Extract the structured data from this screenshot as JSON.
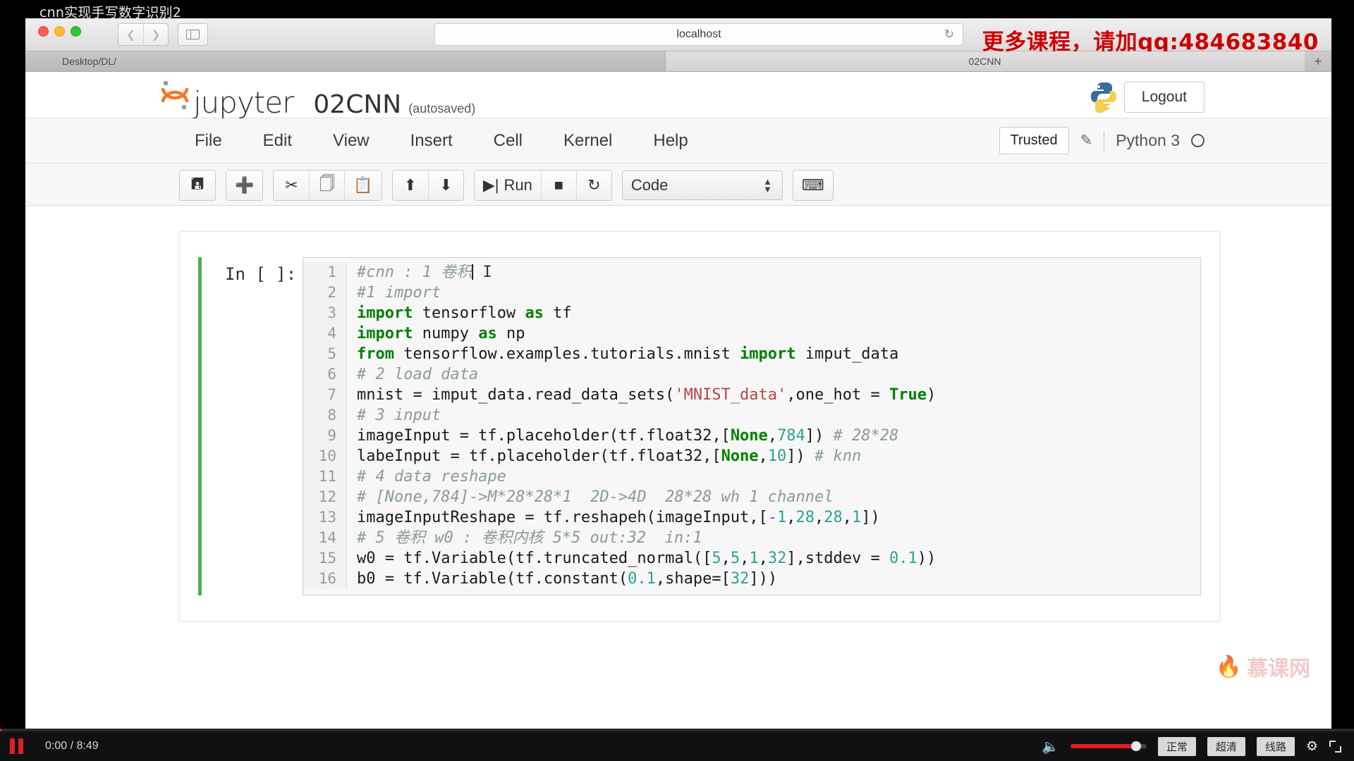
{
  "video": {
    "title": "cnn实现手写数字识别2",
    "pause_icon": "pause-icon",
    "timecode": "0:00 / 8:49",
    "quality_buttons": [
      "正常",
      "超清",
      "线路"
    ],
    "speaker_icon": "volume-icon",
    "gear_icon": "settings-gear-icon",
    "fullscreen_icon": "fullscreen-icon",
    "volume_percent": 85
  },
  "browser": {
    "traffic_lights": [
      "close",
      "minimize",
      "maximize"
    ],
    "back_icon": "chevron-left-icon",
    "forward_icon": "chevron-right-icon",
    "sidebar_icon": "sidebar-toggle-icon",
    "url": "localhost",
    "reload_icon": "reload-icon",
    "watermark": "更多课程，请加qq:484683840",
    "tabs": [
      {
        "label": "Desktop/DL/",
        "active": false
      },
      {
        "label": "02CNN",
        "active": true
      }
    ],
    "new_tab_label": "+"
  },
  "jupyter": {
    "logo_word": "jupyter",
    "logo_icon": "jupyter-logo-icon",
    "notebook_name": "02CNN",
    "save_state": "(autosaved)",
    "python_logo_icon": "python-logo-icon",
    "logout_label": "Logout",
    "menu": [
      "File",
      "Edit",
      "View",
      "Insert",
      "Cell",
      "Kernel",
      "Help"
    ],
    "trusted_label": "Trusted",
    "pencil_icon": "pencil-edit-icon",
    "kernel_name": "Python 3",
    "kernel_status_icon": "kernel-idle-circle-icon",
    "toolbar": {
      "save_icon": "save-floppy-icon",
      "insert_icon": "add-cell-plus-icon",
      "cut_icon": "scissors-cut-icon",
      "copy_icon": "copy-icon",
      "paste_icon": "paste-icon",
      "move_up_icon": "arrow-up-icon",
      "move_down_icon": "arrow-down-icon",
      "run_icon": "run-play-icon",
      "run_label": "Run",
      "stop_icon": "stop-square-icon",
      "restart_icon": "restart-circular-arrow-icon",
      "cell_type": "Code",
      "cell_type_arrows": "▲▼",
      "keyboard_icon": "keyboard-shortcuts-icon"
    },
    "watermark": "慕课网",
    "watermark_icon": "imooc-flame-icon"
  },
  "notebook": {
    "prompt": "In [ ]:",
    "lines": [
      {
        "n": "1",
        "tokens": [
          {
            "t": "com",
            "v": "#cnn : 1 卷积"
          },
          {
            "t": "caret",
            "v": ""
          },
          {
            "t": "ibeam",
            "v": " I"
          }
        ]
      },
      {
        "n": "2",
        "tokens": [
          {
            "t": "com",
            "v": "#1 import"
          }
        ]
      },
      {
        "n": "3",
        "tokens": [
          {
            "t": "kw",
            "v": "import"
          },
          {
            "t": "txt",
            "v": " tensorflow "
          },
          {
            "t": "kw",
            "v": "as"
          },
          {
            "t": "txt",
            "v": " tf"
          }
        ]
      },
      {
        "n": "4",
        "tokens": [
          {
            "t": "kw",
            "v": "import"
          },
          {
            "t": "txt",
            "v": " numpy "
          },
          {
            "t": "kw",
            "v": "as"
          },
          {
            "t": "txt",
            "v": " np"
          }
        ]
      },
      {
        "n": "5",
        "tokens": [
          {
            "t": "kw",
            "v": "from"
          },
          {
            "t": "txt",
            "v": " tensorflow.examples.tutorials.mnist "
          },
          {
            "t": "kw",
            "v": "import"
          },
          {
            "t": "txt",
            "v": " imput_data"
          }
        ]
      },
      {
        "n": "6",
        "tokens": [
          {
            "t": "com",
            "v": "# 2 load data"
          }
        ]
      },
      {
        "n": "7",
        "tokens": [
          {
            "t": "txt",
            "v": "mnist = imput_data.read_data_sets("
          },
          {
            "t": "str",
            "v": "'MNIST_data'"
          },
          {
            "t": "txt",
            "v": ",one_hot = "
          },
          {
            "t": "kw",
            "v": "True"
          },
          {
            "t": "txt",
            "v": ")"
          }
        ]
      },
      {
        "n": "8",
        "tokens": [
          {
            "t": "com",
            "v": "# 3 input"
          }
        ]
      },
      {
        "n": "9",
        "tokens": [
          {
            "t": "txt",
            "v": "imageInput = tf.placeholder(tf.float32,["
          },
          {
            "t": "kw",
            "v": "None"
          },
          {
            "t": "txt",
            "v": ","
          },
          {
            "t": "num",
            "v": "784"
          },
          {
            "t": "txt",
            "v": "]) "
          },
          {
            "t": "com",
            "v": "# 28*28"
          }
        ]
      },
      {
        "n": "10",
        "tokens": [
          {
            "t": "txt",
            "v": "labeInput = tf.placeholder(tf.float32,["
          },
          {
            "t": "kw",
            "v": "None"
          },
          {
            "t": "txt",
            "v": ","
          },
          {
            "t": "num",
            "v": "10"
          },
          {
            "t": "txt",
            "v": "]) "
          },
          {
            "t": "com",
            "v": "# knn"
          }
        ]
      },
      {
        "n": "11",
        "tokens": [
          {
            "t": "com",
            "v": "# 4 data reshape"
          }
        ]
      },
      {
        "n": "12",
        "tokens": [
          {
            "t": "com",
            "v": "# [None,784]->M*28*28*1  2D->4D  28*28 wh 1 channel"
          }
        ]
      },
      {
        "n": "13",
        "tokens": [
          {
            "t": "txt",
            "v": "imageInputReshape = tf.reshapeh(imageInput,["
          },
          {
            "t": "op",
            "v": "-"
          },
          {
            "t": "num",
            "v": "1"
          },
          {
            "t": "txt",
            "v": ","
          },
          {
            "t": "num",
            "v": "28"
          },
          {
            "t": "txt",
            "v": ","
          },
          {
            "t": "num",
            "v": "28"
          },
          {
            "t": "txt",
            "v": ","
          },
          {
            "t": "num",
            "v": "1"
          },
          {
            "t": "txt",
            "v": "])"
          }
        ]
      },
      {
        "n": "14",
        "tokens": [
          {
            "t": "com",
            "v": "# 5 卷积 w0 : 卷积内核 5*5 out:32  in:1"
          }
        ]
      },
      {
        "n": "15",
        "tokens": [
          {
            "t": "txt",
            "v": "w0 = tf.Variable(tf.truncated_normal(["
          },
          {
            "t": "num",
            "v": "5"
          },
          {
            "t": "txt",
            "v": ","
          },
          {
            "t": "num",
            "v": "5"
          },
          {
            "t": "txt",
            "v": ","
          },
          {
            "t": "num",
            "v": "1"
          },
          {
            "t": "txt",
            "v": ","
          },
          {
            "t": "num",
            "v": "32"
          },
          {
            "t": "txt",
            "v": "],stddev = "
          },
          {
            "t": "num",
            "v": "0.1"
          },
          {
            "t": "txt",
            "v": "))"
          }
        ]
      },
      {
        "n": "16",
        "tokens": [
          {
            "t": "txt",
            "v": "b0 = tf.Variable(tf.constant("
          },
          {
            "t": "num",
            "v": "0.1"
          },
          {
            "t": "txt",
            "v": ",shape=["
          },
          {
            "t": "num",
            "v": "32"
          },
          {
            "t": "txt",
            "v": "]))"
          }
        ]
      }
    ]
  },
  "colors": {
    "cell_accent": "#4caf50",
    "watermark_red": "#cc0000",
    "keyword_green": "#008000",
    "string_red": "#bb4444",
    "comment_grey": "#8a9a9a",
    "number_teal": "#2aa198",
    "player_red": "#e02020"
  }
}
